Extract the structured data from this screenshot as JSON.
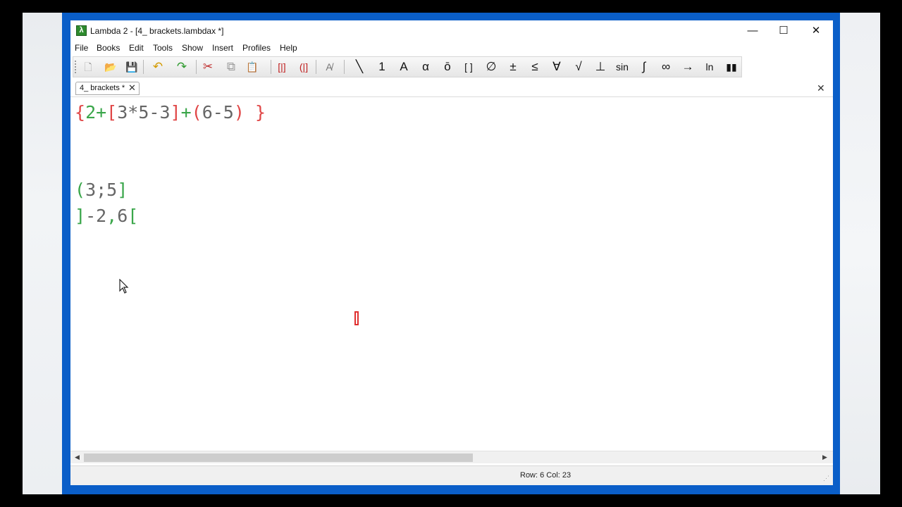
{
  "window": {
    "title": "Lambda 2 - [4_ brackets.lambdax *]",
    "minimize": "—",
    "maximize": "☐",
    "close": "✕"
  },
  "menu": [
    "File",
    "Books",
    "Edit",
    "Tools",
    "Show",
    "Insert",
    "Profiles",
    "Help"
  ],
  "toolbar": [
    {
      "name": "new-file-icon",
      "glyph": "🗋",
      "color": "#9a9a9a"
    },
    {
      "name": "open-folder-icon",
      "glyph": "📂",
      "color": "#3a6fb0"
    },
    {
      "name": "save-icon",
      "glyph": "💾",
      "color": "#3a6fb0"
    },
    {
      "name": "undo-icon",
      "glyph": "↶",
      "color": "#d39a00"
    },
    {
      "name": "redo-icon",
      "glyph": "↷",
      "color": "#2e9a2e"
    },
    {
      "name": "cut-icon",
      "glyph": "✂",
      "color": "#c03030"
    },
    {
      "name": "copy-icon",
      "glyph": "⧉",
      "color": "#9a9a9a"
    },
    {
      "name": "paste-icon",
      "glyph": "📋",
      "color": "#b07a20"
    },
    {
      "name": "brackets-red-icon",
      "glyph": "[|]",
      "color": "#c02020"
    },
    {
      "name": "brackets-alt-icon",
      "glyph": "(|]",
      "color": "#c02020"
    },
    {
      "name": "font-size-icon",
      "glyph": "A̸",
      "color": "#777777"
    },
    {
      "name": "line-icon",
      "glyph": "╲",
      "color": "#111111"
    },
    {
      "name": "number-icon",
      "glyph": "1",
      "color": "#111111"
    },
    {
      "name": "letter-a-icon",
      "glyph": "A",
      "color": "#111111"
    },
    {
      "name": "alpha-icon",
      "glyph": "α",
      "color": "#111111"
    },
    {
      "name": "overline-icon",
      "glyph": "ō",
      "color": "#111111"
    },
    {
      "name": "square-brackets-icon",
      "glyph": "[ ]",
      "color": "#111111"
    },
    {
      "name": "empty-set-icon",
      "glyph": "∅",
      "color": "#111111"
    },
    {
      "name": "plus-minus-icon",
      "glyph": "±",
      "color": "#111111"
    },
    {
      "name": "less-equal-icon",
      "glyph": "≤",
      "color": "#111111"
    },
    {
      "name": "forall-icon",
      "glyph": "∀",
      "color": "#111111"
    },
    {
      "name": "sqrt-icon",
      "glyph": "√",
      "color": "#111111"
    },
    {
      "name": "perpendicular-icon",
      "glyph": "⊥",
      "color": "#111111"
    },
    {
      "name": "sin-icon",
      "glyph": "sin",
      "color": "#111111"
    },
    {
      "name": "integral-icon",
      "glyph": "∫",
      "color": "#111111"
    },
    {
      "name": "infinity-icon",
      "glyph": "∞",
      "color": "#111111"
    },
    {
      "name": "arrow-icon",
      "glyph": "→",
      "color": "#111111"
    },
    {
      "name": "ln-icon",
      "glyph": "ln",
      "color": "#111111"
    },
    {
      "name": "bar-chart-icon",
      "glyph": "▮▮",
      "color": "#111111"
    }
  ],
  "tab": {
    "label": "4_ brackets *",
    "close": "✕"
  },
  "editor_close": "✕",
  "editor": {
    "lines": [
      [
        [
          "{",
          "red"
        ],
        [
          "2+",
          "green"
        ],
        [
          "[",
          "red"
        ],
        [
          "3*5-3",
          "plain"
        ],
        [
          "]",
          "red"
        ],
        [
          "+",
          "green"
        ],
        [
          "(",
          "red"
        ],
        [
          "6-5",
          "plain"
        ],
        [
          ")",
          "red"
        ],
        [
          " }",
          "red"
        ]
      ],
      [
        [
          "(",
          "green"
        ],
        [
          "3;5",
          "plain"
        ],
        [
          "]",
          "green"
        ]
      ],
      [
        [
          "]",
          "green"
        ],
        [
          "-2",
          "plain"
        ],
        [
          ",",
          "green"
        ],
        [
          "6",
          "plain"
        ],
        [
          "[",
          "green"
        ]
      ]
    ]
  },
  "status": {
    "text": "Row: 6  Col: 23"
  },
  "scroll": {
    "left": "◀",
    "right": "▶",
    "thumb_fraction": 0.53
  },
  "colors": {
    "red": "#e04646",
    "green": "#3aa64a",
    "frame": "#0a5ec8"
  }
}
